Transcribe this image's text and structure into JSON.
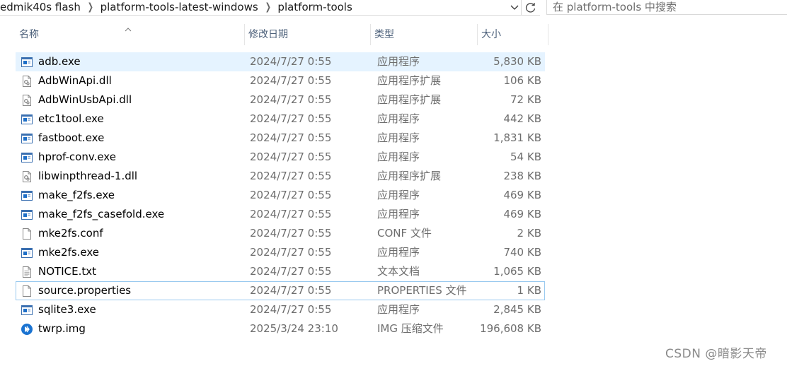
{
  "address": {
    "crumbs": [
      "edmik40s flash",
      "platform-tools-latest-windows",
      "platform-tools"
    ],
    "search_placeholder": "在 platform-tools 中搜索"
  },
  "columns": {
    "name": "名称",
    "date": "修改日期",
    "type": "类型",
    "size": "大小"
  },
  "files": [
    {
      "name": "adb.exe",
      "date": "2024/7/27 0:55",
      "type": "应用程序",
      "size": "5,830 KB",
      "icon": "exe-icon"
    },
    {
      "name": "AdbWinApi.dll",
      "date": "2024/7/27 0:55",
      "type": "应用程序扩展",
      "size": "106 KB",
      "icon": "dll-icon"
    },
    {
      "name": "AdbWinUsbApi.dll",
      "date": "2024/7/27 0:55",
      "type": "应用程序扩展",
      "size": "72 KB",
      "icon": "dll-icon"
    },
    {
      "name": "etc1tool.exe",
      "date": "2024/7/27 0:55",
      "type": "应用程序",
      "size": "442 KB",
      "icon": "exe-icon"
    },
    {
      "name": "fastboot.exe",
      "date": "2024/7/27 0:55",
      "type": "应用程序",
      "size": "1,831 KB",
      "icon": "exe-icon"
    },
    {
      "name": "hprof-conv.exe",
      "date": "2024/7/27 0:55",
      "type": "应用程序",
      "size": "54 KB",
      "icon": "exe-icon"
    },
    {
      "name": "libwinpthread-1.dll",
      "date": "2024/7/27 0:55",
      "type": "应用程序扩展",
      "size": "238 KB",
      "icon": "dll-icon"
    },
    {
      "name": "make_f2fs.exe",
      "date": "2024/7/27 0:55",
      "type": "应用程序",
      "size": "469 KB",
      "icon": "exe-icon"
    },
    {
      "name": "make_f2fs_casefold.exe",
      "date": "2024/7/27 0:55",
      "type": "应用程序",
      "size": "469 KB",
      "icon": "exe-icon"
    },
    {
      "name": "mke2fs.conf",
      "date": "2024/7/27 0:55",
      "type": "CONF 文件",
      "size": "2 KB",
      "icon": "blank-file-icon"
    },
    {
      "name": "mke2fs.exe",
      "date": "2024/7/27 0:55",
      "type": "应用程序",
      "size": "740 KB",
      "icon": "exe-icon"
    },
    {
      "name": "NOTICE.txt",
      "date": "2024/7/27 0:55",
      "type": "文本文档",
      "size": "1,065 KB",
      "icon": "text-file-icon"
    },
    {
      "name": "source.properties",
      "date": "2024/7/27 0:55",
      "type": "PROPERTIES 文件",
      "size": "1 KB",
      "icon": "blank-file-icon"
    },
    {
      "name": "sqlite3.exe",
      "date": "2024/7/27 0:55",
      "type": "应用程序",
      "size": "2,845 KB",
      "icon": "exe-icon"
    },
    {
      "name": "twrp.img",
      "date": "2025/3/24 23:10",
      "type": "IMG 压缩文件",
      "size": "196,608 KB",
      "icon": "disc-image-icon"
    }
  ],
  "watermark": "CSDN @暗影天帝",
  "colors": {
    "header_text": "#4c607a",
    "selected_bg": "#e5f3ff",
    "focus_border": "#99c9ef",
    "meta_text": "#6d6d6d",
    "exe_icon_blue": "#1e6fc7"
  }
}
